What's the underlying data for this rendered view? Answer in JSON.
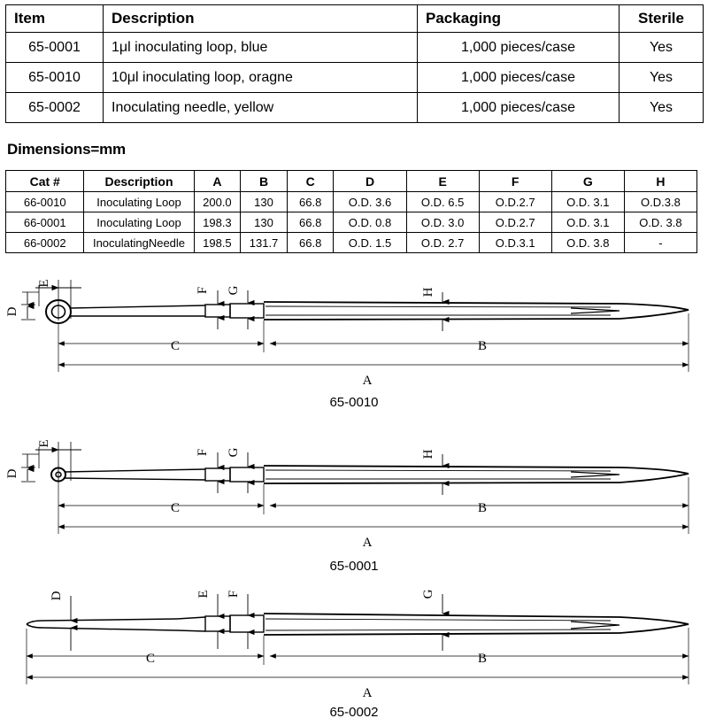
{
  "product_table": {
    "headers": [
      "Item",
      "Description",
      "Packaging",
      "Sterile"
    ],
    "rows": [
      {
        "item": "65-0001",
        "description": "1μl inoculating loop, blue",
        "packaging": "1,000 pieces/case",
        "sterile": "Yes"
      },
      {
        "item": "65-0010",
        "description": "10μl inoculating loop, oragne",
        "packaging": "1,000 pieces/case",
        "sterile": "Yes"
      },
      {
        "item": "65-0002",
        "description": "Inoculating needle, yellow",
        "packaging": "1,000 pieces/case",
        "sterile": "Yes"
      }
    ]
  },
  "dimensions_heading": "Dimensions=mm",
  "dimensions_table": {
    "headers": [
      "Cat #",
      "Description",
      "A",
      "B",
      "C",
      "D",
      "E",
      "F",
      "G",
      "H"
    ],
    "rows": [
      {
        "cat": "66-0010",
        "description": "Inoculating Loop",
        "A": "200.0",
        "B": "130",
        "C": "66.8",
        "D": "O.D. 3.6",
        "E": "O.D. 6.5",
        "F": "O.D.2.7",
        "G": "O.D. 3.1",
        "H": "O.D.3.8"
      },
      {
        "cat": "66-0001",
        "description": "Inoculating Loop",
        "A": "198.3",
        "B": "130",
        "C": "66.8",
        "D": "O.D. 0.8",
        "E": "O.D. 3.0",
        "F": "O.D.2.7",
        "G": "O.D. 3.1",
        "H": "O.D. 3.8"
      },
      {
        "cat": "66-0002",
        "description": "InoculatingNeedle",
        "A": "198.5",
        "B": "131.7",
        "C": "66.8",
        "D": "O.D. 1.5",
        "E": "O.D. 2.7",
        "F": "O.D.3.1",
        "G": "O.D. 3.8",
        "H": "-"
      }
    ]
  },
  "drawings": [
    {
      "part_number": "65-0010",
      "type": "inoculating-loop-large",
      "callouts_vertical": [
        "D",
        "E",
        "F",
        "G",
        "H"
      ],
      "callouts_horizontal": [
        "C",
        "B",
        "A"
      ]
    },
    {
      "part_number": "65-0001",
      "type": "inoculating-loop-small",
      "callouts_vertical": [
        "D",
        "E",
        "F",
        "G",
        "H"
      ],
      "callouts_horizontal": [
        "C",
        "B",
        "A"
      ]
    },
    {
      "part_number": "65-0002",
      "type": "inoculating-needle",
      "callouts_vertical": [
        "D",
        "E",
        "F",
        "G"
      ],
      "callouts_horizontal": [
        "C",
        "B",
        "A"
      ]
    }
  ],
  "drawing_labels": {
    "D": "D",
    "E": "E",
    "F": "F",
    "G": "G",
    "H": "H",
    "A": "A",
    "B": "B",
    "C": "C"
  }
}
